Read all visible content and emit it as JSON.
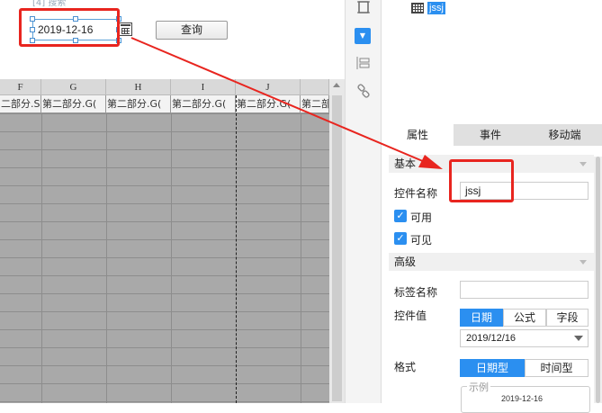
{
  "design": {
    "hint_text": "[4] 搜索",
    "date_value": "2019-12-16",
    "query_button": "查询",
    "calendar_icon": "calendar-icon"
  },
  "sheet": {
    "columns": [
      "F",
      "G",
      "H",
      "I",
      "J",
      ""
    ],
    "fields": [
      "二部分.S(",
      "第二部分.G(",
      "第二部分.G(",
      "第二部分.G(",
      "第二部分.G(",
      "第二部"
    ]
  },
  "toolbar": {
    "icons": [
      "frame-icon",
      "widget-icon",
      "layout-icon",
      "link-icon"
    ]
  },
  "tree": {
    "node_label": "jssj"
  },
  "tabs": [
    "属性",
    "事件",
    "移动端"
  ],
  "props": {
    "basic_section": "基本",
    "control_name_label": "控件名称",
    "control_name_value": "jssj",
    "enabled_label": "可用",
    "visible_label": "可见",
    "advanced_section": "高级",
    "tag_name_label": "标签名称",
    "tag_name_value": "",
    "control_value_label": "控件值",
    "value_types": [
      "日期",
      "公式",
      "字段"
    ],
    "date_value": "2019/12/16",
    "format_label": "格式",
    "format_types": [
      "日期型",
      "时间型"
    ],
    "example_label": "示例",
    "example_value": "2019-12-16"
  },
  "colors": {
    "accent": "#2b8ff0",
    "highlight": "#e8251f"
  }
}
